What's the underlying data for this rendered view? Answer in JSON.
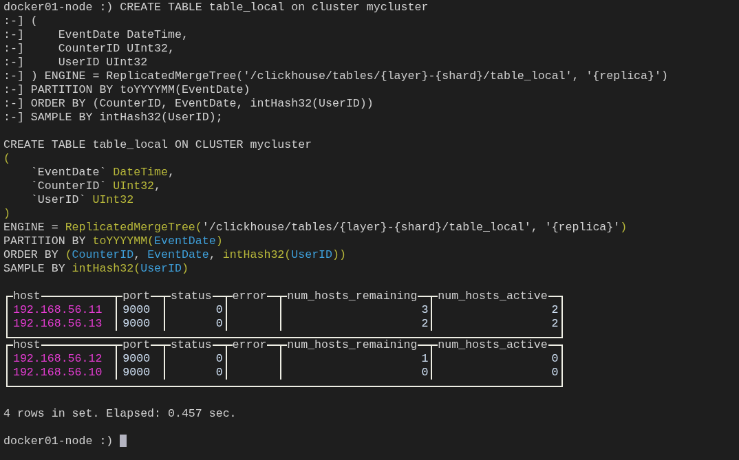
{
  "terminal": {
    "lines": [
      {
        "kind": "command",
        "prompt": "docker01-node :)",
        "text": "CREATE TABLE table_local on cluster mycluster"
      },
      {
        "kind": "command",
        "prompt": ":-]",
        "text": "("
      },
      {
        "kind": "command",
        "prompt": ":-]",
        "text": "    EventDate DateTime,"
      },
      {
        "kind": "command",
        "prompt": ":-]",
        "text": "    CounterID UInt32,"
      },
      {
        "kind": "command",
        "prompt": ":-]",
        "text": "    UserID UInt32"
      },
      {
        "kind": "command",
        "prompt": ":-]",
        "text": ") ENGINE = ReplicatedMergeTree('/clickhouse/tables/{layer}-{shard}/table_local', '{replica}')"
      },
      {
        "kind": "command",
        "prompt": ":-]",
        "text": "PARTITION BY toYYYYMM(EventDate)"
      },
      {
        "kind": "command",
        "prompt": ":-]",
        "text": "ORDER BY (CounterID, EventDate, intHash32(UserID))"
      },
      {
        "kind": "command",
        "prompt": ":-]",
        "text": "SAMPLE BY intHash32(UserID);"
      },
      {
        "kind": "blank"
      },
      {
        "kind": "sql",
        "segments": [
          {
            "kind": "plain",
            "text": "CREATE TABLE table_local ON CLUSTER mycluster"
          }
        ]
      },
      {
        "kind": "sql",
        "segments": [
          {
            "kind": "punct",
            "text": "("
          }
        ]
      },
      {
        "kind": "sql",
        "segments": [
          {
            "kind": "plain",
            "text": "    `EventDate` "
          },
          {
            "kind": "type",
            "text": "DateTime"
          },
          {
            "kind": "plain",
            "text": ","
          }
        ]
      },
      {
        "kind": "sql",
        "segments": [
          {
            "kind": "plain",
            "text": "    `CounterID` "
          },
          {
            "kind": "type",
            "text": "UInt32"
          },
          {
            "kind": "plain",
            "text": ","
          }
        ]
      },
      {
        "kind": "sql",
        "segments": [
          {
            "kind": "plain",
            "text": "    `UserID` "
          },
          {
            "kind": "type",
            "text": "UInt32"
          }
        ]
      },
      {
        "kind": "sql",
        "segments": [
          {
            "kind": "punct",
            "text": ")"
          }
        ]
      },
      {
        "kind": "sql",
        "segments": [
          {
            "kind": "plain",
            "text": "ENGINE = "
          },
          {
            "kind": "func",
            "text": "ReplicatedMergeTree("
          },
          {
            "kind": "plain",
            "text": "'/clickhouse/tables/{layer}-{shard}/table_local', '{replica}'"
          },
          {
            "kind": "punct",
            "text": ")"
          }
        ]
      },
      {
        "kind": "sql",
        "segments": [
          {
            "kind": "plain",
            "text": "PARTITION BY "
          },
          {
            "kind": "func",
            "text": "toYYYYMM("
          },
          {
            "kind": "ident",
            "text": "EventDate"
          },
          {
            "kind": "punct",
            "text": ")"
          }
        ]
      },
      {
        "kind": "sql",
        "segments": [
          {
            "kind": "plain",
            "text": "ORDER BY "
          },
          {
            "kind": "punct",
            "text": "("
          },
          {
            "kind": "ident",
            "text": "CounterID"
          },
          {
            "kind": "plain",
            "text": ", "
          },
          {
            "kind": "ident",
            "text": "EventDate"
          },
          {
            "kind": "plain",
            "text": ", "
          },
          {
            "kind": "func",
            "text": "intHash32("
          },
          {
            "kind": "ident",
            "text": "UserID"
          },
          {
            "kind": "punct",
            "text": "))"
          }
        ]
      },
      {
        "kind": "sql",
        "segments": [
          {
            "kind": "plain",
            "text": "SAMPLE BY "
          },
          {
            "kind": "func",
            "text": "intHash32("
          },
          {
            "kind": "ident",
            "text": "UserID"
          },
          {
            "kind": "punct",
            "text": ")"
          }
        ]
      },
      {
        "kind": "blank"
      },
      {
        "kind": "table",
        "columns": [
          {
            "name": "host",
            "kind": "host"
          },
          {
            "name": "port",
            "kind": "text"
          },
          {
            "name": "status",
            "kind": "number"
          },
          {
            "name": "error",
            "kind": "text"
          },
          {
            "name": "num_hosts_remaining",
            "kind": "number"
          },
          {
            "name": "num_hosts_active",
            "kind": "number"
          }
        ],
        "rows": [
          [
            "192.168.56.11",
            "9000",
            "0",
            "",
            "3",
            "2"
          ],
          [
            "192.168.56.13",
            "9000",
            "0",
            "",
            "2",
            "2"
          ]
        ]
      },
      {
        "kind": "table",
        "columns": [
          {
            "name": "host",
            "kind": "host"
          },
          {
            "name": "port",
            "kind": "text"
          },
          {
            "name": "status",
            "kind": "number"
          },
          {
            "name": "error",
            "kind": "text"
          },
          {
            "name": "num_hosts_remaining",
            "kind": "number"
          },
          {
            "name": "num_hosts_active",
            "kind": "number"
          }
        ],
        "rows": [
          [
            "192.168.56.12",
            "9000",
            "0",
            "",
            "1",
            "0"
          ],
          [
            "192.168.56.10",
            "9000",
            "0",
            "",
            "0",
            "0"
          ]
        ]
      },
      {
        "kind": "blank"
      },
      {
        "kind": "status",
        "text": "4 rows in set. Elapsed: 0.457 sec."
      },
      {
        "kind": "blank"
      },
      {
        "kind": "prompt",
        "prompt": "docker01-node :)",
        "cursor": true
      }
    ]
  }
}
